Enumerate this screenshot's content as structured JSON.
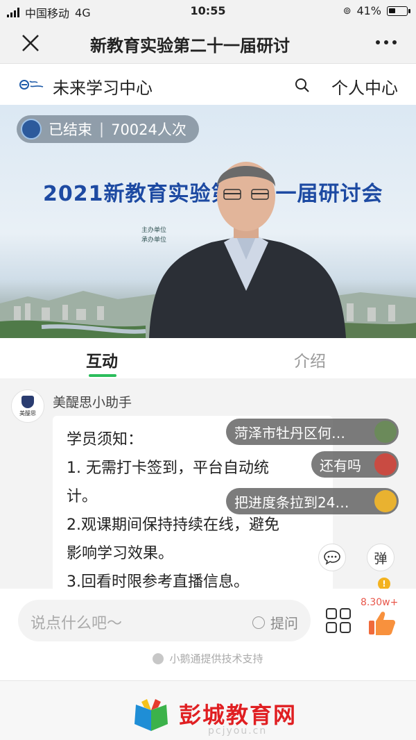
{
  "status_bar": {
    "carrier": "中国移动",
    "network": "4G",
    "time": "10:55",
    "battery": "41%",
    "battery_level": 0.41
  },
  "nav": {
    "title": "新教育实验第二十一届研讨"
  },
  "site_header": {
    "name": "未来学习中心",
    "profile": "个人中心"
  },
  "video": {
    "status": "已结束",
    "viewers": "70024人次",
    "banner": "2021新教育实验第二十一届研讨会",
    "organizer": "主办单位",
    "host_unit": "承办单位"
  },
  "tabs": [
    {
      "label": "互动",
      "active": true
    },
    {
      "label": "介绍",
      "active": false
    }
  ],
  "chat": {
    "sender": "美醍思小助手",
    "avatar_caption": "美醍思",
    "message_lines": [
      "学员须知：",
      "1. 无需打卡签到，平台自动统",
      "计。",
      "2.观课期间保持持续在线，避免",
      "影响学习效果。",
      "3.回看时限参考直播信息。"
    ]
  },
  "danmaku": [
    {
      "text": "菏泽市牡丹区何…",
      "avatar_color": "#6b8a5a"
    },
    {
      "text": "还有吗",
      "avatar_color": "#c94b42"
    },
    {
      "text": "把进度条拉到24…",
      "avatar_color": "#e9b230"
    }
  ],
  "floating_buttons": {
    "danmaku_label": "弹",
    "notice_badge": "!"
  },
  "input": {
    "placeholder": "说点什么吧～",
    "ask_label": "提问"
  },
  "likes": "8.30w+",
  "powered_by": "小鹅通提供技术支持",
  "footer": {
    "brand": "彭城教育网",
    "url": "pcjyou.cn"
  },
  "colors": {
    "accent_green": "#2bbd5b",
    "brand_red": "#e01f22",
    "banner_blue": "#1d4aa2"
  }
}
